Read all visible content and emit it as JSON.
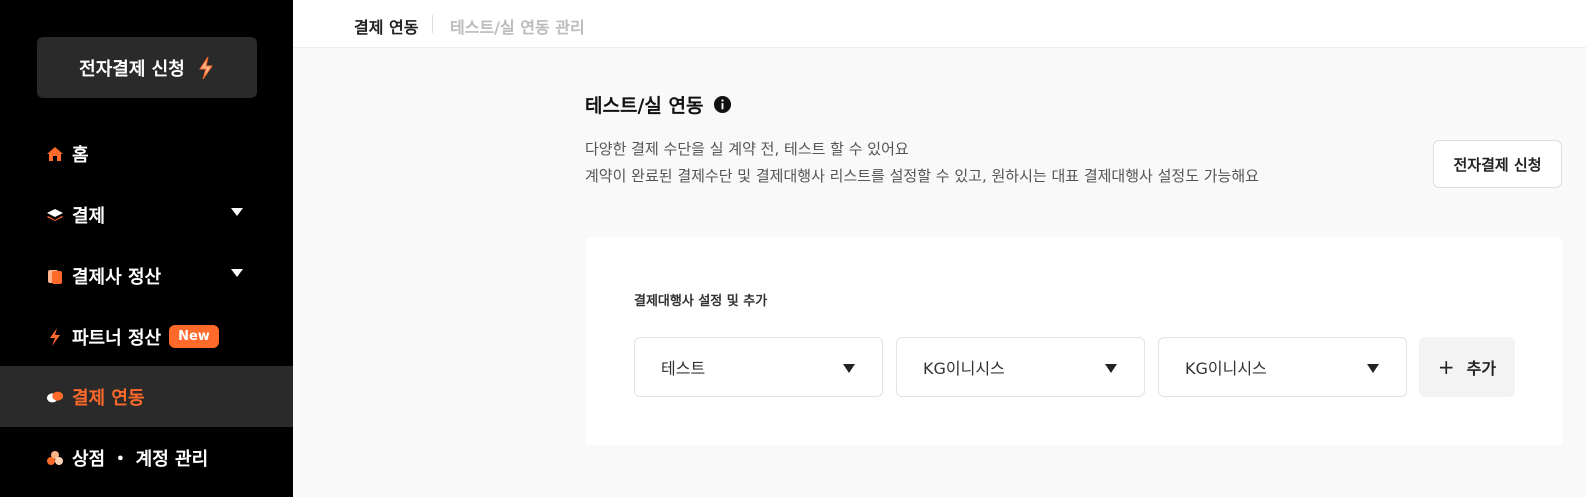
{
  "sidebar": {
    "apply_button": {
      "label": "전자결제 신청",
      "icon": "bolt-icon"
    },
    "items": [
      {
        "label": "홈",
        "icon": "home-icon",
        "has_caret": false
      },
      {
        "label": "결제",
        "icon": "layers-icon",
        "has_caret": true
      },
      {
        "label": "결제사 정산",
        "icon": "documents-icon",
        "has_caret": true
      },
      {
        "label": "파트너 정산",
        "icon": "bolt-icon",
        "badge": "New",
        "has_caret": false
      },
      {
        "label": "결제 연동",
        "icon": "pills-icon",
        "active": true,
        "has_caret": false
      },
      {
        "label": "상점 ・ 계정 관리",
        "icon": "store-icon",
        "has_caret": false
      }
    ]
  },
  "header": {
    "breadcrumbs": [
      "결제 연동",
      "테스트/실 연동 관리"
    ]
  },
  "main": {
    "title": "테스트/실 연동",
    "description_lines": [
      "다양한 결제 수단을 실 계약 전, 테스트 할 수 있어요",
      "계약이 완료된 결제수단 및 결제대행사 리스트를 설정할 수 있고, 원하시는 대표 결제대행사 설정도 가능해요"
    ],
    "apply_button": "전자결제 신청",
    "card": {
      "title": "결제대행사 설정 및 추가",
      "selects": [
        {
          "value": "테스트"
        },
        {
          "value": "KG이니시스"
        },
        {
          "value": "KG이니시스"
        }
      ],
      "add_button": "추가"
    }
  },
  "colors": {
    "accent": "#ff6a2b",
    "sidebar_bg": "#000000",
    "active_bg": "#2a2a2a",
    "page_bg": "#f9f9f9"
  }
}
